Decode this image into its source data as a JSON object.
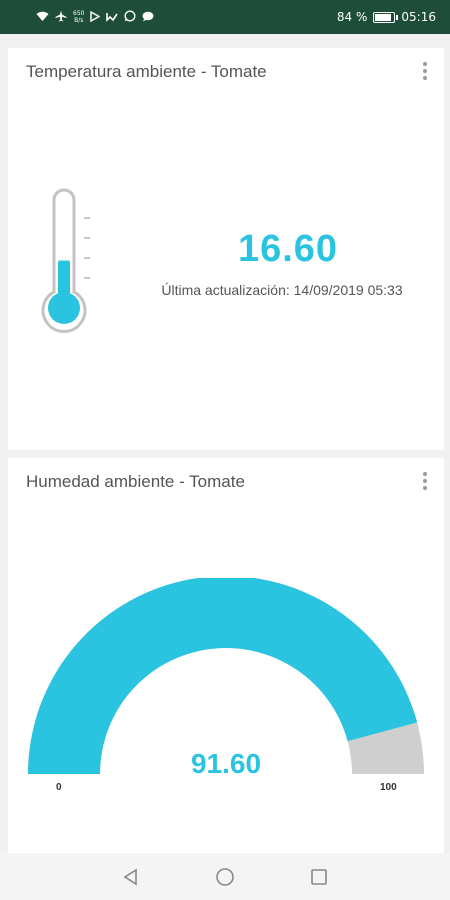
{
  "status_bar": {
    "net_speed_value": "650",
    "net_speed_unit": "B/s",
    "battery_percent": "84 %",
    "battery_level": 0.84,
    "time": "05:16",
    "icons": [
      "wifi-icon",
      "airplane-icon",
      "play-store-icon",
      "notification-icon",
      "whatsapp-icon",
      "chat-icon"
    ]
  },
  "temperature_card": {
    "title": "Temperatura ambiente - Tomate",
    "value": "16.60",
    "last_update": "Última actualización: 14/09/2019 05:33",
    "level": 0.45
  },
  "humidity_card": {
    "title": "Humedad ambiente - Tomate",
    "value": "91.60",
    "min_label": "0",
    "max_label": "100",
    "value_num": 91.6,
    "min_num": 0,
    "max_num": 100
  },
  "colors": {
    "accent": "#2bc4e0",
    "gauge_track": "#cfcfcf",
    "status_bar": "#1e4d3a"
  },
  "nav_bar": {
    "icons": [
      "back-icon",
      "home-icon",
      "recents-icon"
    ]
  }
}
